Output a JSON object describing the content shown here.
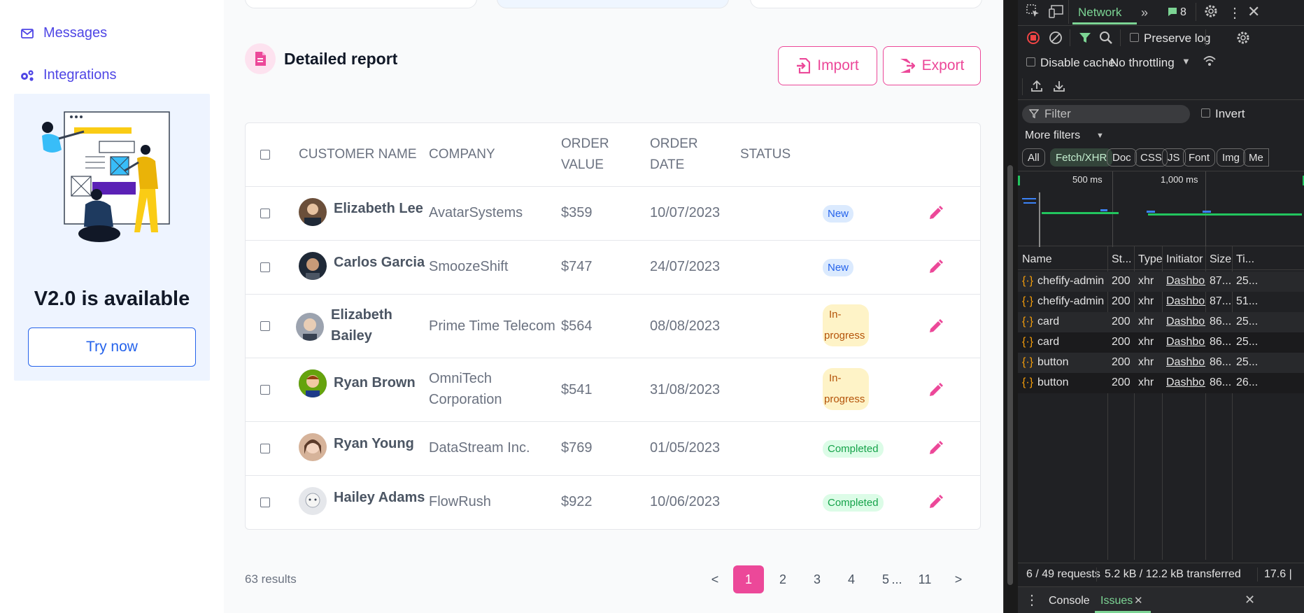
{
  "sidebar": {
    "messages": "Messages",
    "integrations": "Integrations",
    "promo_title": "V2.0 is available",
    "promo_button": "Try now"
  },
  "report": {
    "title": "Detailed report",
    "import": "Import",
    "export": "Export"
  },
  "table": {
    "headers": {
      "customer": "CUSTOMER NAME",
      "company": "COMPANY",
      "order_value_1": "ORDER",
      "order_value_2": "VALUE",
      "order_date_1": "ORDER",
      "order_date_2": "DATE",
      "status": "STATUS"
    },
    "rows": [
      {
        "name": "Elizabeth Lee",
        "company": "AvatarSystems",
        "value": "$359",
        "date": "10/07/2023",
        "status": "New"
      },
      {
        "name": "Carlos Garcia",
        "company": "SmoozeShift",
        "value": "$747",
        "date": "24/07/2023",
        "status": "New"
      },
      {
        "name_1": "Elizabeth",
        "name_2": "Bailey",
        "company": "Prime Time Telecom",
        "value": "$564",
        "date": "08/08/2023",
        "status_1": "In-",
        "status_2": "progress"
      },
      {
        "name": "Ryan Brown",
        "company_1": "OmniTech",
        "company_2": "Corporation",
        "value": "$541",
        "date": "31/08/2023",
        "status_1": "In-",
        "status_2": "progress"
      },
      {
        "name": "Ryan Young",
        "company": "DataStream Inc.",
        "value": "$769",
        "date": "01/05/2023",
        "status": "Completed"
      },
      {
        "name": "Hailey Adams",
        "company": "FlowRush",
        "value": "$922",
        "date": "10/06/2023",
        "status": "Completed"
      }
    ]
  },
  "pagination": {
    "results": "63 results",
    "prev": "<",
    "next": ">",
    "pages": [
      "1",
      "2",
      "3",
      "4",
      "5"
    ],
    "ellipsis": "...",
    "last": "11",
    "active": "1"
  },
  "devtools": {
    "tab_network": "Network",
    "issues_count": "8",
    "preserve_log": "Preserve log",
    "disable_cache": "Disable cache",
    "throttling": "No throttling",
    "filter_placeholder": "Filter",
    "invert": "Invert",
    "more_filters": "More filters",
    "chips": [
      "All",
      "Fetch/XHR",
      "Doc",
      "CSS",
      "JS",
      "Font",
      "Img",
      "Me"
    ],
    "timeline_500": "500 ms",
    "timeline_1000": "1,000 ms",
    "columns": [
      "Name",
      "St...",
      "Type",
      "Initiator",
      "Size",
      "Ti..."
    ],
    "requests": [
      {
        "name": "chefify-admin",
        "status": "200",
        "type": "xhr",
        "initiator": "Dashboar",
        "size": "87...",
        "time": "25..."
      },
      {
        "name": "chefify-admin",
        "status": "200",
        "type": "xhr",
        "initiator": "Dashboar",
        "size": "87...",
        "time": "51..."
      },
      {
        "name": "card",
        "status": "200",
        "type": "xhr",
        "initiator": "Dashboar",
        "size": "86...",
        "time": "25..."
      },
      {
        "name": "card",
        "status": "200",
        "type": "xhr",
        "initiator": "Dashboar",
        "size": "86...",
        "time": "25..."
      },
      {
        "name": "button",
        "status": "200",
        "type": "xhr",
        "initiator": "Dashboar",
        "size": "86...",
        "time": "25..."
      },
      {
        "name": "button",
        "status": "200",
        "type": "xhr",
        "initiator": "Dashboar",
        "size": "86...",
        "time": "26..."
      }
    ],
    "summary_requests": "6 / 49 requests",
    "summary_transferred": "5.2 kB / 12.2 kB transferred",
    "summary_resources": "17.6 |",
    "drawer_console": "Console",
    "drawer_issues": "Issues"
  }
}
